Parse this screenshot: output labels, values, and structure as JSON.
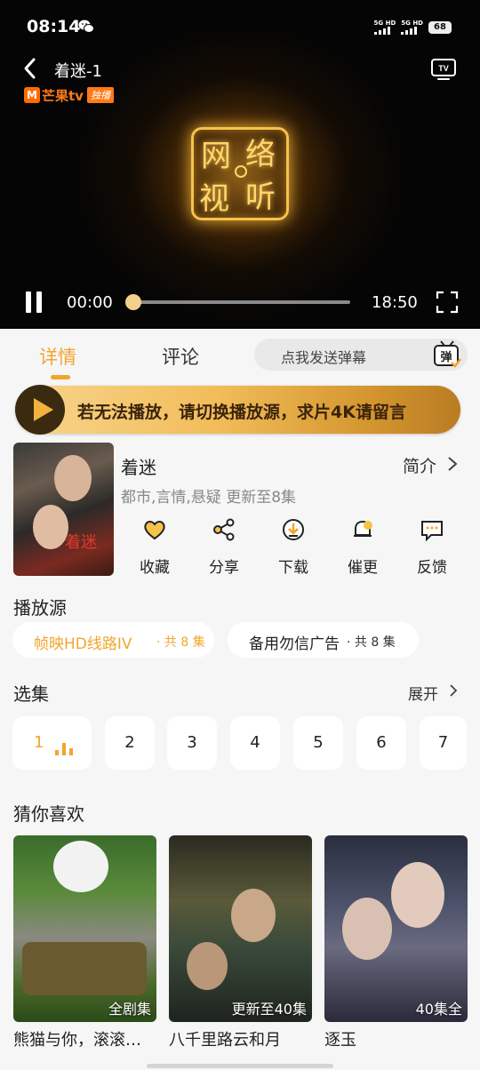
{
  "status_bar": {
    "time": "08:14",
    "signal_1": "5G HD",
    "signal_2": "5G HD",
    "battery": "68"
  },
  "player": {
    "title": "着迷-1",
    "brand_name": "芒果tv",
    "brand_badge": "独播",
    "logo_chars": [
      "网",
      "络",
      "视",
      "听"
    ],
    "current_time": "00:00",
    "total_time": "18:50",
    "progress": 0.0
  },
  "tabs": {
    "detail": "详情",
    "comments": "评论",
    "danmaku_placeholder": "点我发送弹幕",
    "danmaku_icon_text": "弹"
  },
  "banner": {
    "message": "若无法播放，请切换播放源，求片4K请留言"
  },
  "show": {
    "poster_title": "着迷",
    "title": "着迷",
    "intro_label": "简介",
    "meta": "都市,言情,悬疑 更新至8集",
    "actions": [
      "收藏",
      "分享",
      "下载",
      "催更",
      "反馈"
    ]
  },
  "sources": {
    "title": "播放源",
    "items": [
      {
        "name": "帧映HD线路IV",
        "count": "· 共 8 集"
      },
      {
        "name": "备用勿信广告",
        "count": "· 共 8 集"
      }
    ]
  },
  "episodes": {
    "title": "选集",
    "expand_label": "展开",
    "items": [
      "1",
      "2",
      "3",
      "4",
      "5",
      "6",
      "7"
    ]
  },
  "recommendations": {
    "title": "猜你喜欢",
    "items": [
      {
        "name": "熊猫与你，滚滚…",
        "badge": "全剧集"
      },
      {
        "name": "八千里路云和月",
        "badge": "更新至40集"
      },
      {
        "name": "逐玉",
        "badge": "40集全"
      }
    ]
  },
  "colors": {
    "accent": "#f2a52d",
    "banner_gradient": [
      "#f7d58e",
      "#b97c22"
    ],
    "player_bg": "#050505"
  }
}
